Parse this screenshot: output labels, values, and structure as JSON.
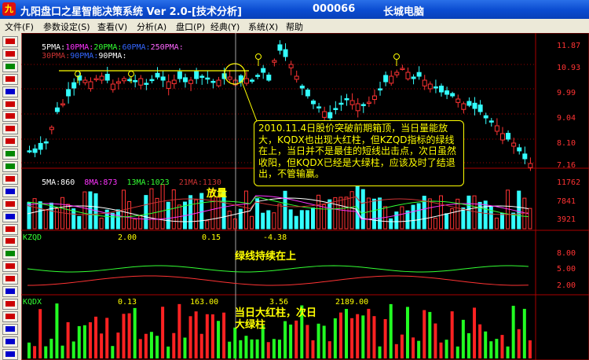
{
  "window": {
    "title": "九阳盘口之星智能决策系统 Ver 2.0-[技术分析]",
    "code": "000066",
    "stock_name": "长城电脑",
    "icon": "app-logo-icon"
  },
  "menu": [
    "文件(F)",
    "参数设定(S)",
    "查看(V)",
    "分析(A)",
    "盘口(P)",
    "经典(Y)",
    "系统(X)",
    "帮助"
  ],
  "toolbar_icons": [
    "line-chart-icon",
    "candle-chart-icon",
    "trend-icon",
    "wave-icon",
    "bars-icon",
    "grid-icon",
    "arrow-icon",
    "up-down-icon",
    "w-icon",
    "star-icon",
    "tree-icon",
    "calc-icon",
    "doc-icon",
    "f10-icon",
    "info-icon",
    "table-icon",
    "split-icon",
    "stock-icon",
    "chart2-icon",
    "notes-icon",
    "bars2-icon",
    "list-icon",
    "menu-icon",
    "pmk-icon",
    "pmk2-icon",
    "mail-icon"
  ],
  "price_panel": {
    "ma_row1": [
      {
        "text": "5PMA:",
        "color": "#ffffff"
      },
      {
        "text": "10PMA:",
        "color": "#ff33ff"
      },
      {
        "text": "20PMA:",
        "color": "#33ff33"
      },
      {
        "text": "60PMA:",
        "color": "#3366ff"
      },
      {
        "text": "250PMA:",
        "color": "#ff66ff"
      }
    ],
    "ma_row2": [
      {
        "text": "30PMA:",
        "color": "#cc3333"
      },
      {
        "text": "90PMA:",
        "color": "#3366ff"
      },
      {
        "text": "90PMA:",
        "color": "#ffffff"
      }
    ],
    "axis": [
      "11.87",
      "10.93",
      "9.99",
      "9.04",
      "8.10",
      "7.16"
    ]
  },
  "annotation": "2010.11.4日股价突破前期箱顶，当日量能放大，KQDX也出现大红柱，但KZQD指标的绿线在上，当日并不是最佳的短线出击点，次日虽然收阳，但KQDX已经是大绿柱，应该及时了结退出，不管输赢。",
  "volume_panel": {
    "labels": [
      {
        "text": "5MA:860",
        "color": "#ffffff"
      },
      {
        "text": "8MA:873",
        "color": "#ff33ff"
      },
      {
        "text": "13MA:1023",
        "color": "#33ff33"
      },
      {
        "text": "21MA:1130",
        "color": "#cc3333"
      }
    ],
    "axis": [
      "11762",
      "7841",
      "3921"
    ],
    "note": "放量"
  },
  "kzqd_panel": {
    "name": "KZQD",
    "values": [
      "2.00",
      "0.15",
      "-4.38"
    ],
    "axis": [
      "8.00",
      "5.00",
      "2.00"
    ],
    "note": "绿线持续在上"
  },
  "kqdx_panel": {
    "name": "KQDX",
    "values": [
      "0.13",
      "163.00",
      "3.56",
      "2189.00"
    ],
    "note_line1": "当日大红柱，次日",
    "note_line2": "大绿柱"
  },
  "colors": {
    "up": "#ff3333",
    "down": "#33ffff",
    "green": "#33ff33",
    "yellow": "#ffff00",
    "grid": "#880000"
  }
}
